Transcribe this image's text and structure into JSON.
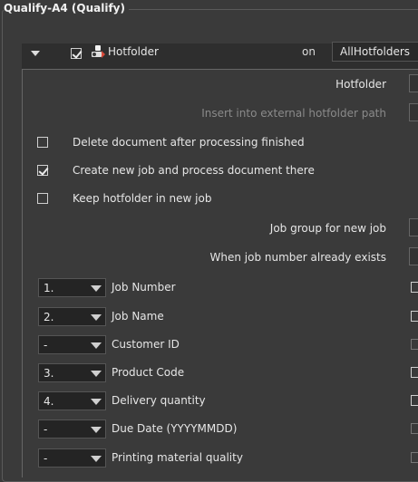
{
  "group": {
    "title": "Qualify-A4 (Qualify)"
  },
  "header": {
    "hotfolder_label": "Hotfolder",
    "on_label": "on",
    "location_value": "AllHotfolders",
    "enabled": true
  },
  "panel": {
    "hotfolder_field_label": "Hotfolder",
    "insert_path_label": "Insert into external hotfolder path",
    "options": [
      {
        "label": "Delete document after processing finished",
        "checked": false
      },
      {
        "label": "Create new job and process document there",
        "checked": true
      },
      {
        "label": "Keep hotfolder in new job",
        "checked": false
      }
    ],
    "job_group_label": "Job group for new job",
    "job_exists_label": "When job number already exists",
    "fields": [
      {
        "order": "1.",
        "label": "Job Number"
      },
      {
        "order": "2.",
        "label": "Job Name"
      },
      {
        "order": "-",
        "label": "Customer ID"
      },
      {
        "order": "3.",
        "label": "Product Code"
      },
      {
        "order": "4.",
        "label": "Delivery quantity"
      },
      {
        "order": "-",
        "label": "Due Date (YYYYMMDD)"
      },
      {
        "order": "-",
        "label": "Printing material quality"
      }
    ]
  }
}
